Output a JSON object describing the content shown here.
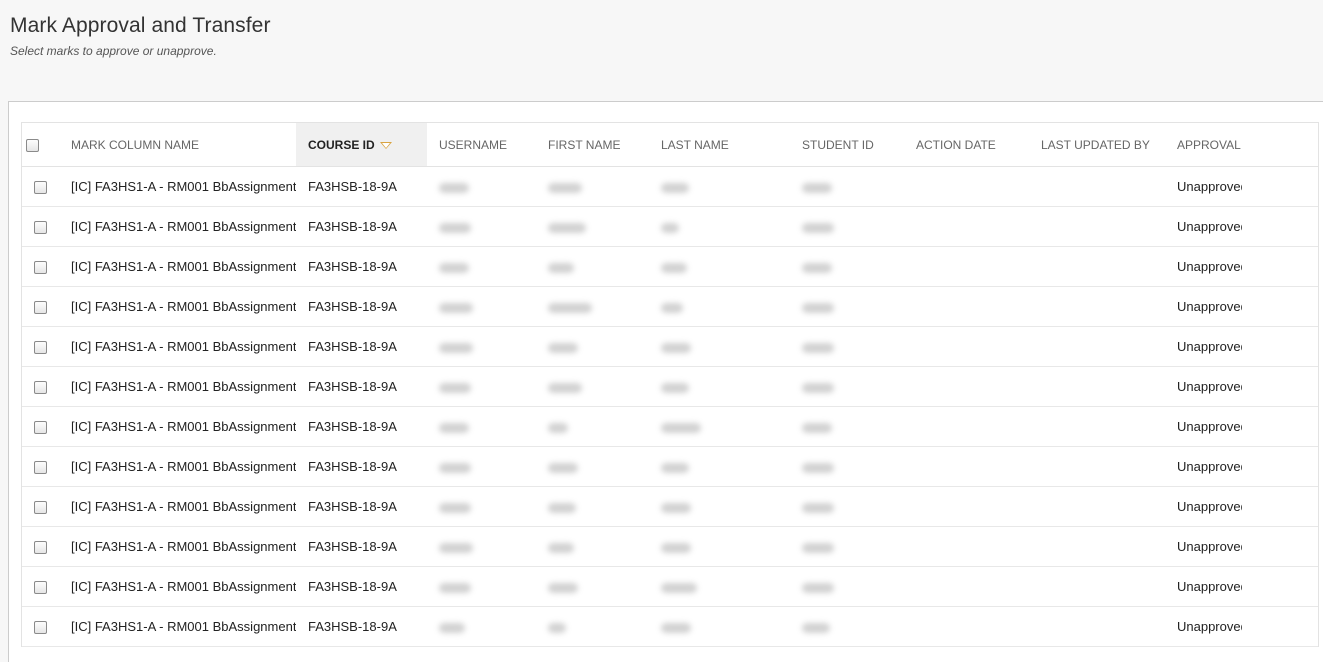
{
  "page": {
    "title": "Mark Approval and Transfer",
    "subtitle": "Select marks to approve or unapprove."
  },
  "table": {
    "columns": [
      {
        "key": "mark_column_name",
        "label": "MARK COLUMN NAME"
      },
      {
        "key": "course_id",
        "label": "COURSE ID",
        "sorted": true,
        "sort_direction": "descending"
      },
      {
        "key": "username",
        "label": "USERNAME"
      },
      {
        "key": "first_name",
        "label": "FIRST NAME"
      },
      {
        "key": "last_name",
        "label": "LAST NAME"
      },
      {
        "key": "student_id",
        "label": "STUDENT ID"
      },
      {
        "key": "action_date",
        "label": "ACTION DATE"
      },
      {
        "key": "last_updated_by",
        "label": "LAST UPDATED BY"
      },
      {
        "key": "approval_status",
        "label": "APPROVAL STATUS"
      }
    ],
    "rows": [
      {
        "mark_column_name": "[IC] FA3HS1-A - RM001 BbAssignment",
        "course_id": "FA3HSB-18-9A",
        "approval_status": "Unapproved",
        "checked": false
      },
      {
        "mark_column_name": "[IC] FA3HS1-A - RM001 BbAssignment",
        "course_id": "FA3HSB-18-9A",
        "approval_status": "Unapproved",
        "checked": false
      },
      {
        "mark_column_name": "[IC] FA3HS1-A - RM001 BbAssignment",
        "course_id": "FA3HSB-18-9A",
        "approval_status": "Unapproved",
        "checked": false
      },
      {
        "mark_column_name": "[IC] FA3HS1-A - RM001 BbAssignment",
        "course_id": "FA3HSB-18-9A",
        "approval_status": "Unapproved",
        "checked": false
      },
      {
        "mark_column_name": "[IC] FA3HS1-A - RM001 BbAssignment",
        "course_id": "FA3HSB-18-9A",
        "approval_status": "Unapproved",
        "checked": false
      },
      {
        "mark_column_name": "[IC] FA3HS1-A - RM001 BbAssignment",
        "course_id": "FA3HSB-18-9A",
        "approval_status": "Unapproved",
        "checked": false
      },
      {
        "mark_column_name": "[IC] FA3HS1-A - RM001 BbAssignment",
        "course_id": "FA3HSB-18-9A",
        "approval_status": "Unapproved",
        "checked": false
      },
      {
        "mark_column_name": "[IC] FA3HS1-A - RM001 BbAssignment",
        "course_id": "FA3HSB-18-9A",
        "approval_status": "Unapproved",
        "checked": false
      },
      {
        "mark_column_name": "[IC] FA3HS1-A - RM001 BbAssignment",
        "course_id": "FA3HSB-18-9A",
        "approval_status": "Unapproved",
        "checked": false
      },
      {
        "mark_column_name": "[IC] FA3HS1-A - RM001 BbAssignment",
        "course_id": "FA3HSB-18-9A",
        "approval_status": "Unapproved",
        "checked": false
      },
      {
        "mark_column_name": "[IC] FA3HS1-A - RM001 BbAssignment",
        "course_id": "FA3HSB-18-9A",
        "approval_status": "Unapproved",
        "checked": false
      },
      {
        "mark_column_name": "[IC] FA3HS1-A - RM001 BbAssignment",
        "course_id": "FA3HSB-18-9A",
        "approval_status": "Unapproved",
        "checked": false
      }
    ]
  },
  "colors": {
    "page_background": "#f7f7f7",
    "sorted_header_background": "#f0f0f0",
    "sort_arrow": "#d9a441"
  }
}
